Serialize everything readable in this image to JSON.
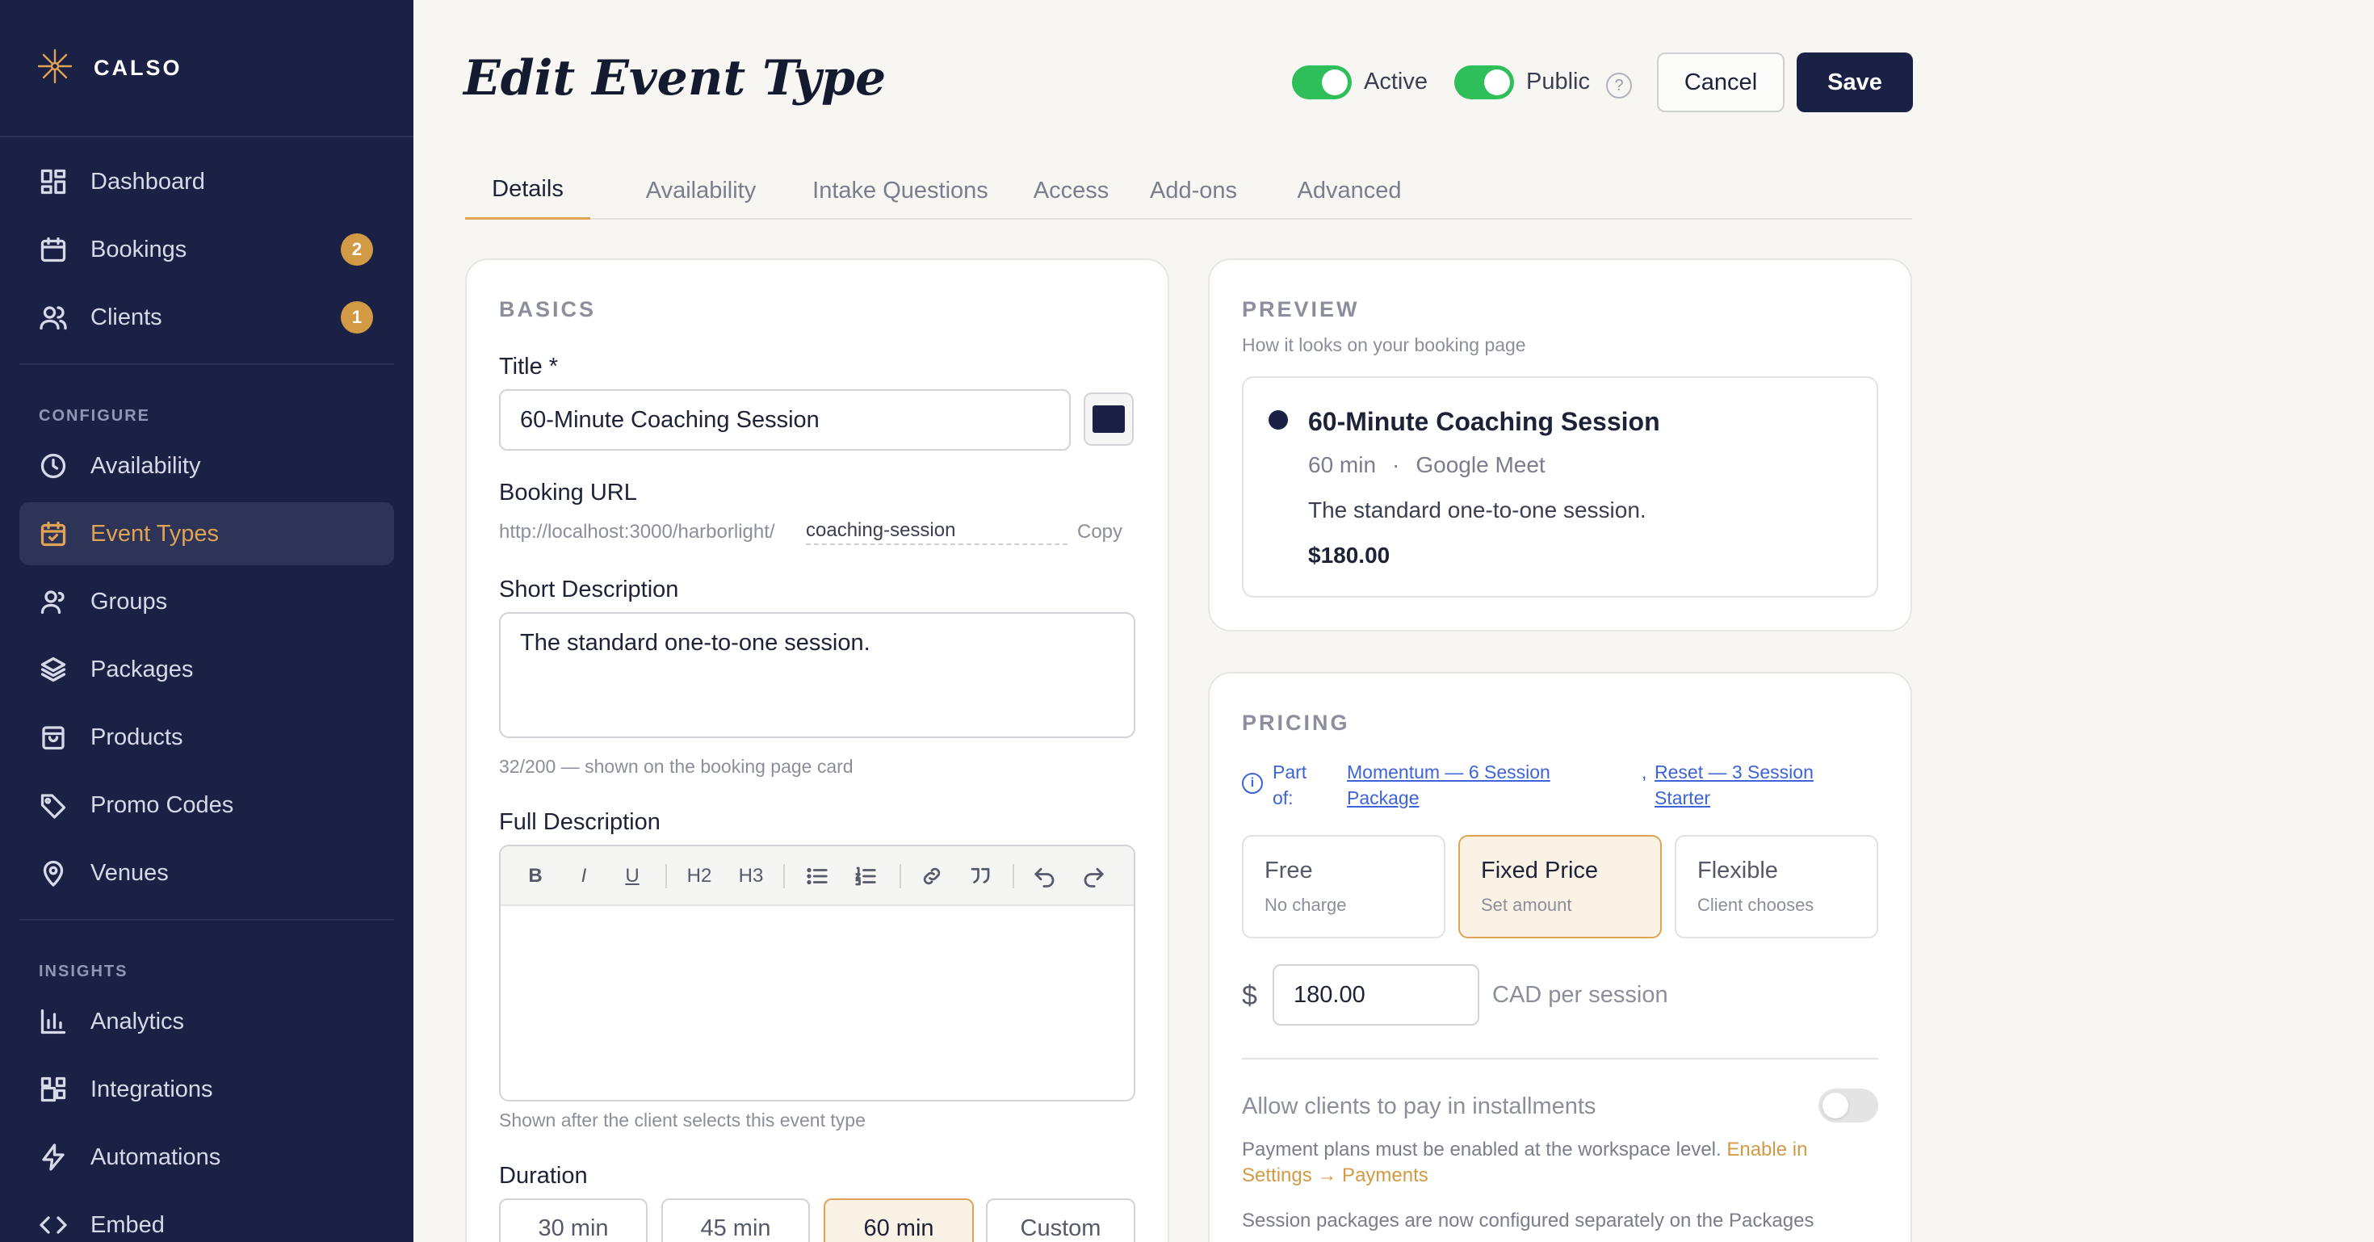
{
  "app": {
    "name": "CALSO"
  },
  "sidebar": {
    "items": [
      {
        "label": "Dashboard",
        "icon": "dashboard-icon"
      },
      {
        "label": "Bookings",
        "icon": "calendar-icon",
        "badge": "2"
      },
      {
        "label": "Clients",
        "icon": "users-icon",
        "badge": "1"
      },
      {
        "label": "Availability",
        "icon": "clock-icon"
      },
      {
        "label": "Event Types",
        "icon": "calendar-check-icon",
        "active": true
      },
      {
        "label": "Groups",
        "icon": "group-icon"
      },
      {
        "label": "Packages",
        "icon": "layers-icon"
      },
      {
        "label": "Products",
        "icon": "bag-icon"
      },
      {
        "label": "Promo Codes",
        "icon": "tag-icon"
      },
      {
        "label": "Venues",
        "icon": "map-pin-icon"
      },
      {
        "label": "Analytics",
        "icon": "bar-chart-icon"
      },
      {
        "label": "Integrations",
        "icon": "integrations-icon"
      },
      {
        "label": "Automations",
        "icon": "lightning-icon"
      },
      {
        "label": "Embed",
        "icon": "code-icon"
      }
    ],
    "sections": {
      "configure": "CONFIGURE",
      "insights": "INSIGHTS"
    }
  },
  "header": {
    "title": "Edit Event Type",
    "active_label": "Active",
    "public_label": "Public",
    "help": "?",
    "cancel": "Cancel",
    "save": "Save"
  },
  "tabs": [
    "Details",
    "Availability",
    "Intake Questions",
    "Access",
    "Add-ons",
    "Advanced"
  ],
  "basics": {
    "section_title": "BASICS",
    "title_label": "Title *",
    "title_value": "60-Minute Coaching Session",
    "url_label": "Booking URL",
    "url_prefix": "http://localhost:3000/harborlight/",
    "url_slug": "coaching-session",
    "copy": "Copy",
    "short_desc_label": "Short Description",
    "short_desc_value": "The standard one-to-one session.",
    "short_desc_hint": "32/200 — shown on the booking page card",
    "full_desc_label": "Full Description",
    "full_desc_hint": "Shown after the client selects this event type",
    "toolbar": {
      "bold": "B",
      "italic": "I",
      "underline": "U",
      "h2": "H2",
      "h3": "H3"
    },
    "duration_label": "Duration",
    "durations": [
      "30 min",
      "45 min",
      "60 min",
      "Custom"
    ],
    "selected_duration": "60 min"
  },
  "preview": {
    "section_title": "PREVIEW",
    "subtitle": "How it looks on your booking page",
    "event_title": "60-Minute Coaching Session",
    "duration": "60 min",
    "separator": "·",
    "location": "Google Meet",
    "description": "The standard one-to-one session.",
    "price": "$180.00"
  },
  "pricing": {
    "section_title": "PRICING",
    "part_of_label": "Part of:",
    "package_1": "Momentum — 6 Session Package",
    "comma": ",",
    "package_2": "Reset — 3 Session Starter",
    "options": [
      {
        "title": "Free",
        "sub": "No charge"
      },
      {
        "title": "Fixed Price",
        "sub": "Set amount",
        "active": true
      },
      {
        "title": "Flexible",
        "sub": "Client chooses"
      }
    ],
    "currency_symbol": "$",
    "amount": "180.00",
    "unit": "CAD per session",
    "installments_label": "Allow clients to pay in installments",
    "installments_enabled": false,
    "installments_note": "Payment plans must be enabled at the workspace level.",
    "installments_link": "Enable in Settings → Payments",
    "packages_note": "Session packages are now configured separately on the Packages"
  },
  "colors": {
    "sidebar": "#1b2145",
    "accent": "#e0a253",
    "toggle_on": "#2fbf5a",
    "link": "#3d63d8"
  }
}
